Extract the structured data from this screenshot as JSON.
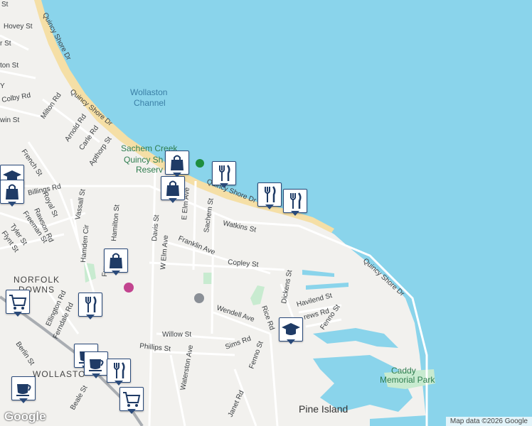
{
  "map": {
    "water_labels": [
      "Wollaston",
      "Channel"
    ],
    "park_labels": [
      "Sachem Creek",
      "Quincy Sh",
      "Reserv",
      "Caddy",
      "Memorial Park"
    ],
    "area_labels": [
      "NORFOLK",
      "DOWNS",
      "WOLLASTO"
    ],
    "island_label": "Pine Island",
    "streets": {
      "quincy_shore_dr_1": "Quincy Shore Dr",
      "quincy_shore_dr_2": "Quincy Shore Dr",
      "quincy_shore_dr_3": "Quincy Shore Dr",
      "hovey": "Hovey St",
      "st_top": "St",
      "st_2": "r St",
      "ton": "ton St",
      "y": "Y",
      "colby": "Colby Rd",
      "milton": "Milton Rd",
      "win": "win St",
      "arnold": "Arnold Rd",
      "carle": "Carle Rd",
      "apthorp": "Apthorp St",
      "french": "French St",
      "billings": "Billings Rd",
      "royal": "Royal St",
      "rawson": "Rawson Rd",
      "freeman": "Freeman St",
      "tyler": "Tyler St",
      "flynt": "Flynt St",
      "vassall": "Vassall St",
      "hamden": "Hamden Cir",
      "hamilton": "Hamilton St",
      "davis": "Davis St",
      "w_elm": "W Elm Ave",
      "e_elm": "E Elm Ave",
      "sachem": "Sachem St",
      "franklin": "Franklin Ave",
      "watkins": "Watkins St",
      "copley": "Copley St",
      "dickens": "Dickens St",
      "havilend": "Havilend St",
      "rews": "rews Rd",
      "fenno_1": "Fenno St",
      "fenno_2": "Fenno St",
      "rice": "Rice Rd",
      "wendell": "Wendell Ave",
      "sims": "Sims Rd",
      "willow": "Willow St",
      "phillips": "Phillips St",
      "waterston": "Waterston Ave",
      "ellington": "Ellington Rd",
      "ferndale": "Ferndale Rd",
      "berlin": "Berlin St",
      "beale": "Beale St",
      "janet": "Janet Rd",
      "fur": "Fur"
    }
  },
  "pins": [
    {
      "name": "shopping-pin-1",
      "icon": "shopping-bag-icon"
    },
    {
      "name": "restaurant-pin-1",
      "icon": "fork-knife-icon"
    },
    {
      "name": "shopping-pin-2",
      "icon": "shopping-bag-icon"
    },
    {
      "name": "restaurant-pin-2",
      "icon": "fork-knife-icon"
    },
    {
      "name": "restaurant-pin-3",
      "icon": "fork-knife-icon"
    },
    {
      "name": "school-pin-1",
      "icon": "graduation-cap-icon"
    },
    {
      "name": "shopping-pin-3",
      "icon": "shopping-bag-icon"
    },
    {
      "name": "shopping-pin-4",
      "icon": "shopping-bag-icon"
    },
    {
      "name": "grocery-pin-1",
      "icon": "shopping-cart-icon"
    },
    {
      "name": "restaurant-pin-4",
      "icon": "fork-knife-icon"
    },
    {
      "name": "school-pin-2",
      "icon": "graduation-cap-icon"
    },
    {
      "name": "cafe-pin-1",
      "icon": "coffee-cup-icon"
    },
    {
      "name": "cafe-pin-2",
      "icon": "coffee-cup-icon"
    },
    {
      "name": "restaurant-pin-5",
      "icon": "fork-knife-icon"
    },
    {
      "name": "grocery-pin-2",
      "icon": "shopping-cart-icon"
    },
    {
      "name": "cafe-pin-3",
      "icon": "coffee-cup-icon"
    }
  ],
  "attribution": "Map data ©2026 Google",
  "logo": "Google",
  "colors": {
    "water": "#8ad4eb",
    "land": "#f2f1ee",
    "beach": "#f5dfa6",
    "park": "#c8ebd0",
    "pin_border": "#2a4a7a"
  }
}
